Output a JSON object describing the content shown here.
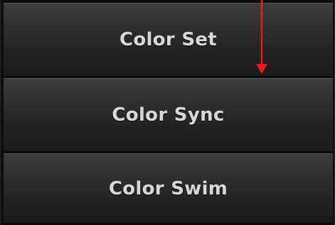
{
  "menu": {
    "items": [
      {
        "label": "Color Set"
      },
      {
        "label": "Color Sync"
      },
      {
        "label": "Color Swim"
      }
    ]
  },
  "annotation": {
    "icon": "arrow-down-icon",
    "color": "#e41e1e"
  },
  "colors": {
    "button_top": "#3d3d3d",
    "button_bottom": "#1a1a1a",
    "label": "#d8d8d8",
    "background": "#0c0c0c"
  }
}
